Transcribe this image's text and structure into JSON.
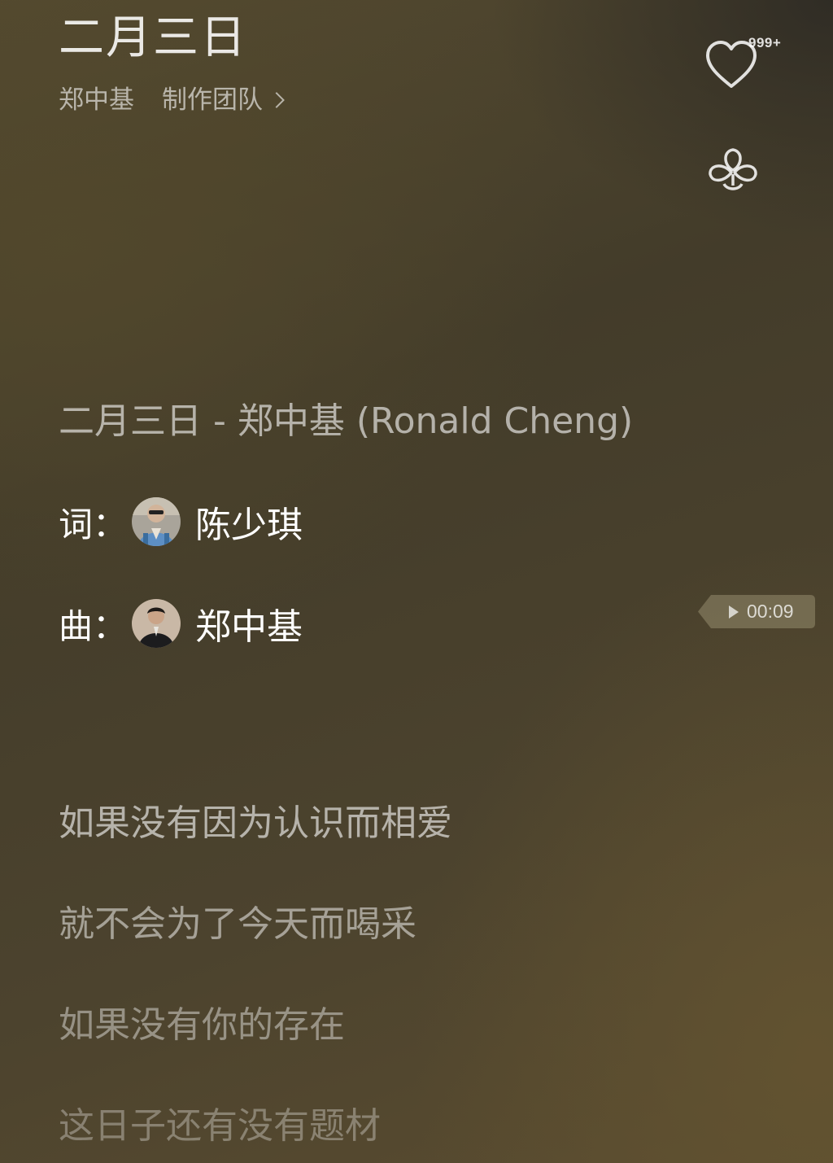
{
  "header": {
    "title": "二月三日",
    "artist": "郑中基",
    "production_team_link": "制作团队",
    "like_count": "999+"
  },
  "icons": {
    "like": "heart-outline-icon",
    "recommend": "clover-icon",
    "chevron": "chevron-right-icon",
    "play": "play-triangle-icon"
  },
  "lyrics": {
    "header_line": "二月三日 - 郑中基 (Ronald Cheng)",
    "lyricist_label": "词：",
    "lyricist_name": "陈少琪",
    "composer_label": "曲：",
    "composer_name": "郑中基",
    "lines": [
      "如果没有因为认识而相爱",
      "就不会为了今天而喝采",
      "如果没有你的存在",
      "这日子还有没有题材"
    ]
  },
  "seek": {
    "timestamp": "00:09"
  },
  "colors": {
    "background_base": "#4a412d",
    "background_dark": "#2d2a24",
    "text_primary": "#ffffff"
  }
}
